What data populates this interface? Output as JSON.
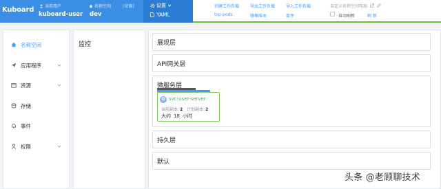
{
  "header": {
    "logo": "Kuboard",
    "current_user_label": "当前用户",
    "current_user": "kuboard-user",
    "namespace_label": "名称空间",
    "namespace": "dev",
    "switch_label": "[切换]",
    "settings_label": "设置",
    "yaml_label": "YAML",
    "actions": {
      "create_workload": "创建工作负载",
      "export_workload": "导出工作负载",
      "import_workload": "导入工作负载",
      "custom_layout": "自定义名称空间布局",
      "top_pods": "top-pods",
      "image_version": "镜像版本",
      "kits": "套件",
      "auto_refresh": "自动刷新",
      "refresh": "刷 新"
    }
  },
  "sidebar": {
    "items": [
      {
        "label": "名称空间",
        "icon": "home-icon",
        "active": true
      },
      {
        "label": "应用程序",
        "icon": "send-icon",
        "expandable": true
      },
      {
        "label": "资源",
        "icon": "box-icon",
        "expandable": true
      },
      {
        "label": "存储",
        "icon": "database-icon"
      },
      {
        "label": "事件",
        "icon": "bell-icon"
      },
      {
        "label": "权限",
        "icon": "user-icon",
        "expandable": true
      }
    ]
  },
  "panel": {
    "title": "监控"
  },
  "layers": [
    {
      "title": "展现层"
    },
    {
      "title": "API网关层"
    },
    {
      "title": "微服务层"
    },
    {
      "title": "持久层"
    },
    {
      "title": "默认"
    }
  ],
  "workload_card": {
    "badge": "D",
    "name": "svc-user-server",
    "current_replicas_label": "当前副本:",
    "current_replicas": "2",
    "planned_replicas_label": "计划副本:",
    "planned_replicas": "2",
    "age_prefix": "大约",
    "age_value": "18",
    "age_unit": "小时"
  },
  "watermark": "头条 @老顾聊技术",
  "colors": {
    "header_blue": "#3a8ee6",
    "accent": "#409eff",
    "card_border": "#85ce61",
    "service_name": "#4caf50"
  }
}
